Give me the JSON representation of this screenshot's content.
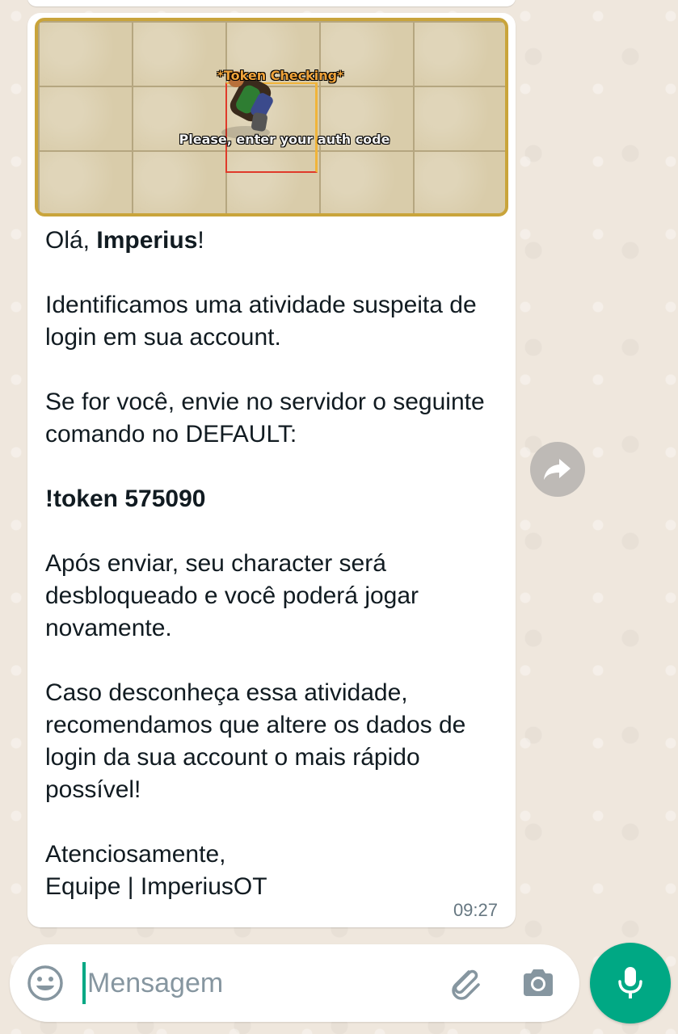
{
  "chat": {
    "message": {
      "image": {
        "title": "*Token Checking*",
        "subtitle": "Please, enter your auth code"
      },
      "greeting_prefix": "Olá, ",
      "greeting_name": "Imperius",
      "greeting_suffix": "!",
      "paragraph_1": "Identificamos uma atividade suspeita de login em sua account.",
      "paragraph_2": "Se for você, envie no servidor o seguinte comando no DEFAULT:",
      "command": "!token 575090",
      "paragraph_3": "Após enviar, seu character será desbloqueado e você poderá jogar novamente.",
      "paragraph_4": "Caso desconheça essa atividade, recomendamos que altere os dados de login da sua account o mais rápido possível!",
      "signoff_1": "Atenciosamente,",
      "signoff_2": "Equipe | ImperiusOT",
      "time": "09:27"
    }
  },
  "composer": {
    "placeholder": "Mensagem",
    "value": ""
  },
  "icons": {
    "forward": "forward-icon",
    "emoji": "emoji-icon",
    "attach": "paperclip-icon",
    "camera": "camera-icon",
    "mic": "microphone-icon"
  },
  "colors": {
    "accent": "#00a884",
    "bubble": "#ffffff",
    "text": "#111b21",
    "meta": "#667781"
  }
}
